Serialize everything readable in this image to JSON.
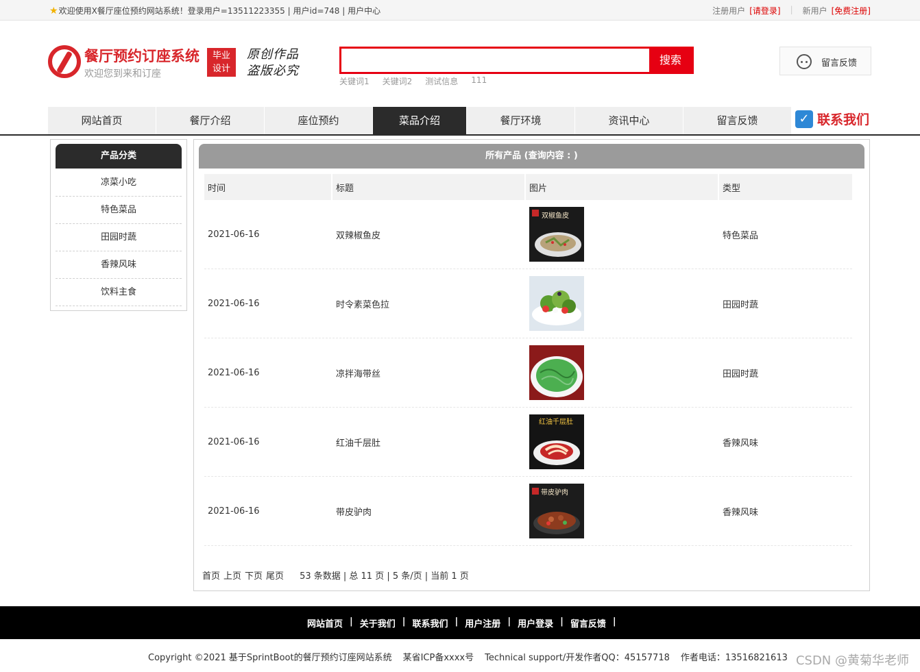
{
  "topbar": {
    "welcome": "欢迎使用X餐厅座位预约网站系统！登录用户=13511223355 | 用户id=748 | 用户中心",
    "register_label": "注册用户",
    "login_link": "[请登录]",
    "new_user_label": "新用户",
    "free_register_link": "[免费注册]"
  },
  "header": {
    "title": "餐厅预约订座系统",
    "subtitle": "欢迎您到来和订座",
    "badge_line1": "毕业",
    "badge_line2": "设计",
    "slogan_line1": "原创作品",
    "slogan_line2": "盗版必究",
    "search_value": "",
    "search_button": "搜索",
    "keywords": [
      "关键词1",
      "关键词2",
      "测试信息",
      "111"
    ],
    "feedback": "留言反馈"
  },
  "nav": {
    "items": [
      "网站首页",
      "餐厅介绍",
      "座位预约",
      "菜品介绍",
      "餐厅环境",
      "资讯中心",
      "留言反馈"
    ],
    "active": "菜品介绍",
    "contact": "联系我们"
  },
  "sidebar": {
    "title": "产品分类",
    "categories": [
      "凉菜小吃",
      "特色菜品",
      "田园时蔬",
      "香辣风味",
      "饮料主食"
    ]
  },
  "main": {
    "title": "所有产品 (查询内容 : )",
    "columns": [
      "时间",
      "标题",
      "图片",
      "类型"
    ],
    "rows": [
      {
        "date": "2021-06-16",
        "title": "双辣椒鱼皮",
        "type": "特色菜品",
        "img_text": "双椒鱼皮"
      },
      {
        "date": "2021-06-16",
        "title": "时令素菜色拉",
        "type": "田园时蔬",
        "img_text": ""
      },
      {
        "date": "2021-06-16",
        "title": "凉拌海带丝",
        "type": "田园时蔬",
        "img_text": ""
      },
      {
        "date": "2021-06-16",
        "title": "红油千层肚",
        "type": "香辣风味",
        "img_text": "红油千层肚"
      },
      {
        "date": "2021-06-16",
        "title": "带皮驴肉",
        "type": "香辣风味",
        "img_text": "带皮驴肉"
      }
    ],
    "pager": {
      "first": "首页",
      "prev": "上页",
      "next": "下页",
      "last": "尾页",
      "info": "53 条数据 | 总 11 页 | 5 条/页 | 当前 1 页"
    }
  },
  "footer": {
    "links": [
      "网站首页",
      "关于我们",
      "联系我们",
      "用户注册",
      "用户登录",
      "留言反馈"
    ],
    "copyright": "Copyright ©2021 基于SprintBoot的餐厅预约订座网站系统",
    "icp": "某省ICP备xxxx号",
    "support": "Technical support/开发作者QQ：45157718",
    "phone": "作者电话：13516821613",
    "watermark": "CSDN @黄菊华老师"
  },
  "colors": {
    "brand_red": "#d8262b",
    "search_red": "#e60012",
    "nav_active": "#2b2b2b"
  }
}
